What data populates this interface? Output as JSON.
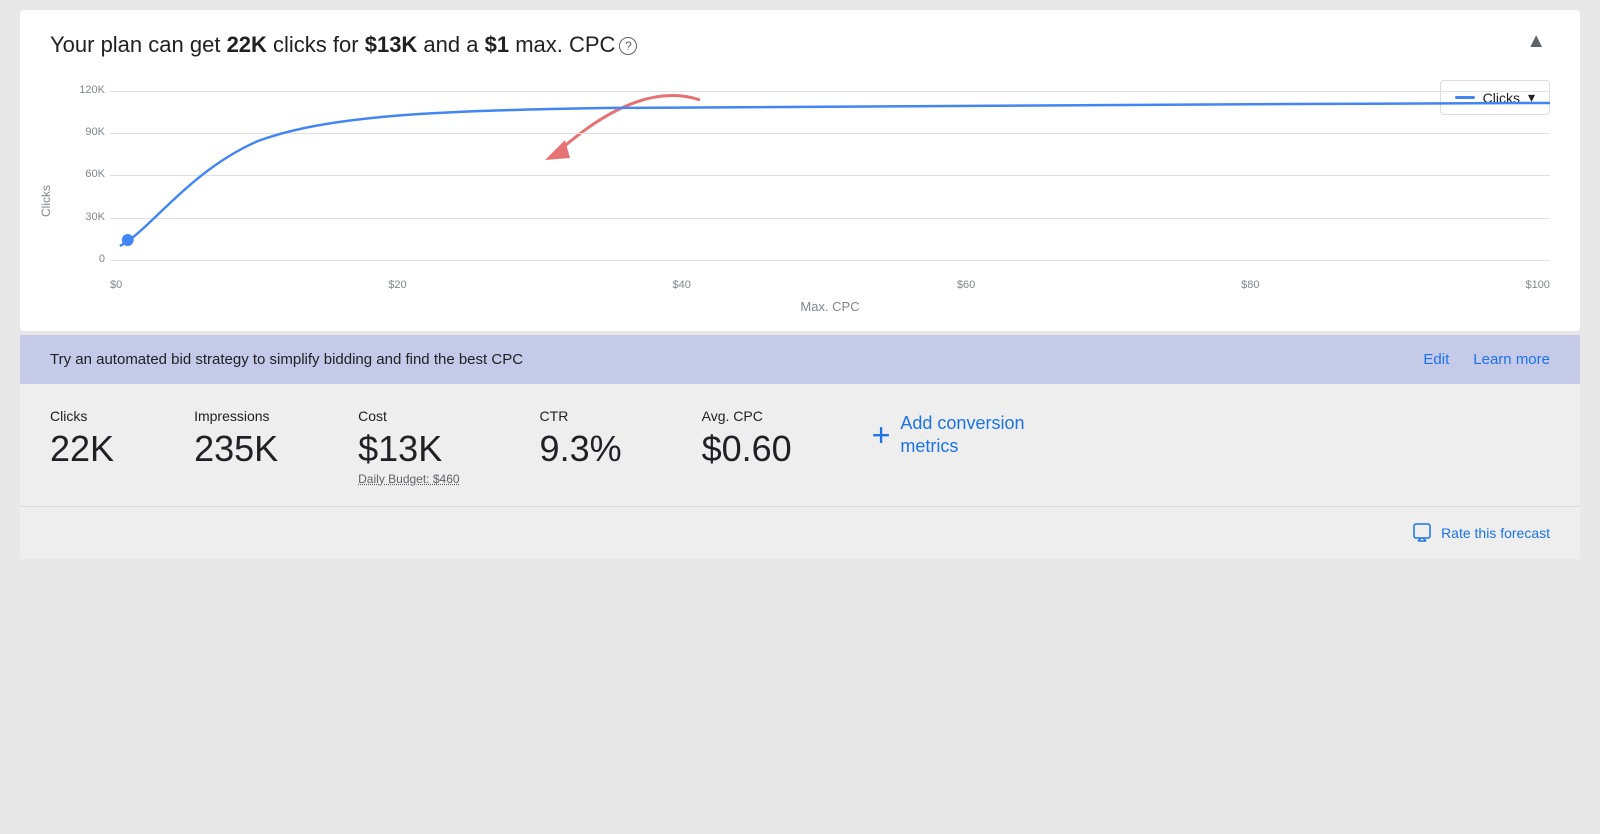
{
  "header": {
    "title_part1": "Your plan can get ",
    "title_clicks": "22K",
    "title_part2": " clicks for ",
    "title_cost": "$13K",
    "title_part3": " and a ",
    "title_cpc": "$1",
    "title_part4": " max. CPC",
    "collapse_label": "▲"
  },
  "chart": {
    "y_axis_label": "Clicks",
    "y_labels": [
      "120K",
      "90K",
      "60K",
      "30K",
      "0"
    ],
    "x_labels": [
      "$0",
      "$20",
      "$40",
      "$60",
      "$80",
      "$100"
    ],
    "x_axis_title": "Max. CPC",
    "legend_label": "Clicks",
    "legend_dropdown": "▾"
  },
  "banner": {
    "text": "Try an automated bid strategy to simplify bidding and find the best CPC",
    "edit_label": "Edit",
    "learn_more_label": "Learn more"
  },
  "metrics": [
    {
      "label": "Clicks",
      "value": "22K",
      "sub": ""
    },
    {
      "label": "Impressions",
      "value": "235K",
      "sub": ""
    },
    {
      "label": "Cost",
      "value": "$13K",
      "sub": "Daily Budget: $460"
    },
    {
      "label": "CTR",
      "value": "9.3%",
      "sub": ""
    },
    {
      "label": "Avg. CPC",
      "value": "$0.60",
      "sub": ""
    }
  ],
  "add_conversion": {
    "label": "Add conversion\nmetrics"
  },
  "footer": {
    "rate_label": "Rate this forecast"
  }
}
